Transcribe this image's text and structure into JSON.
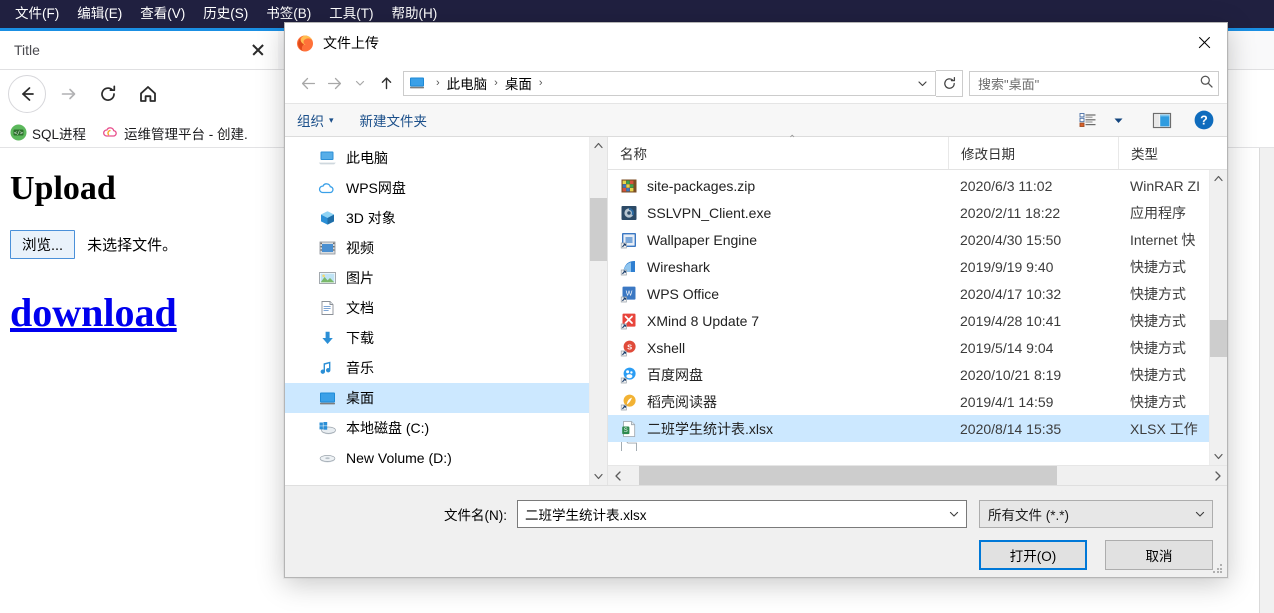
{
  "menubar": {
    "items": [
      {
        "label": "文件(F)"
      },
      {
        "label": "编辑(E)"
      },
      {
        "label": "查看(V)"
      },
      {
        "label": "历史(S)"
      },
      {
        "label": "书签(B)"
      },
      {
        "label": "工具(T)"
      },
      {
        "label": "帮助(H)"
      }
    ]
  },
  "browser": {
    "tab": {
      "title": "Title",
      "close_label": ""
    },
    "nav": {
      "back": "back-arrow",
      "forward": "forward-arrow",
      "reload": "reload-arrow",
      "home": "home-house"
    },
    "bookmarks": [
      {
        "label": "SQL进程",
        "icon": "sql-icon"
      },
      {
        "label": "运维管理平台 - 创建.",
        "icon": "cloud-icon"
      }
    ],
    "page": {
      "heading": "Upload",
      "browse_button": "浏览...",
      "no_file_text": "未选择文件。",
      "download_link": "download"
    }
  },
  "dialog": {
    "title": "文件上传",
    "close_label": "",
    "address": {
      "back": "←",
      "forward": "→",
      "history_caret": "⌄",
      "up": "↑",
      "crumbs": [
        "此电脑",
        "桌面"
      ],
      "crumb_sep": "›",
      "dropdown_caret": "⌄",
      "refresh_label": "↻"
    },
    "search": {
      "placeholder": "搜索\"桌面\"",
      "icon": "magnifier-icon"
    },
    "toolbar": {
      "organize": "组织",
      "organize_caret": "▾",
      "new_folder": "新建文件夹",
      "view_caret": "▾",
      "view_icon": "view-list-icon",
      "pane_icon": "preview-pane-icon",
      "help_icon": "help-icon",
      "help_glyph": "?"
    },
    "tree": {
      "items": [
        {
          "label": "此电脑",
          "icon": "computer-icon",
          "selected": false
        },
        {
          "label": "WPS网盘",
          "icon": "cloud-icon",
          "selected": false
        },
        {
          "label": "3D 对象",
          "icon": "cube-icon",
          "selected": false
        },
        {
          "label": "视频",
          "icon": "video-icon",
          "selected": false
        },
        {
          "label": "图片",
          "icon": "picture-icon",
          "selected": false
        },
        {
          "label": "文档",
          "icon": "document-icon",
          "selected": false
        },
        {
          "label": "下载",
          "icon": "download-icon",
          "selected": false
        },
        {
          "label": "音乐",
          "icon": "music-icon",
          "selected": false
        },
        {
          "label": "桌面",
          "icon": "desktop-icon",
          "selected": true
        },
        {
          "label": "本地磁盘 (C:)",
          "icon": "windows-disk-icon",
          "selected": false
        },
        {
          "label": "New Volume (D:)",
          "icon": "disk-icon",
          "selected": false
        }
      ]
    },
    "columns": {
      "name": "名称",
      "date": "修改日期",
      "type": "类型",
      "sort_marker": "⌃"
    },
    "files": [
      {
        "name": "site-packages.zip",
        "date": "2020/6/3 11:02",
        "type": "WinRAR ZI",
        "icon": "zip-icon",
        "selected": false
      },
      {
        "name": "SSLVPN_Client.exe",
        "date": "2020/2/11 18:22",
        "type": "应用程序",
        "icon": "exe-icon",
        "selected": false
      },
      {
        "name": "Wallpaper Engine",
        "date": "2020/4/30 15:50",
        "type": "Internet 快",
        "icon": "shortcut-icon",
        "selected": false
      },
      {
        "name": "Wireshark",
        "date": "2019/9/19 9:40",
        "type": "快捷方式",
        "icon": "wireshark-icon",
        "selected": false
      },
      {
        "name": "WPS Office",
        "date": "2020/4/17 10:32",
        "type": "快捷方式",
        "icon": "wps-icon",
        "selected": false
      },
      {
        "name": "XMind 8 Update 7",
        "date": "2019/4/28 10:41",
        "type": "快捷方式",
        "icon": "xmind-icon",
        "selected": false
      },
      {
        "name": "Xshell",
        "date": "2019/5/14 9:04",
        "type": "快捷方式",
        "icon": "xshell-icon",
        "selected": false
      },
      {
        "name": "百度网盘",
        "date": "2020/10/21 8:19",
        "type": "快捷方式",
        "icon": "baidu-icon",
        "selected": false
      },
      {
        "name": "稻壳阅读器",
        "date": "2019/4/1 14:59",
        "type": "快捷方式",
        "icon": "reader-icon",
        "selected": false
      },
      {
        "name": "二班学生统计表.xlsx",
        "date": "2020/8/14 15:35",
        "type": "XLSX 工作",
        "icon": "xlsx-icon",
        "selected": true
      }
    ],
    "footer": {
      "filename_label": "文件名(N):",
      "filename_value": "二班学生统计表.xlsx",
      "filename_caret": "⌄",
      "filter_value": "所有文件 (*.*)",
      "filter_caret": "⌄",
      "open_button": "打开(O)",
      "cancel_button": "取消"
    }
  },
  "colors": {
    "menubar_bg": "#202040",
    "accent_blue": "#1a8fe3",
    "selection": "#cce8ff",
    "link": "#0000ee",
    "primary_border": "#0078d7",
    "toolbar_link": "#1b4f8a"
  }
}
